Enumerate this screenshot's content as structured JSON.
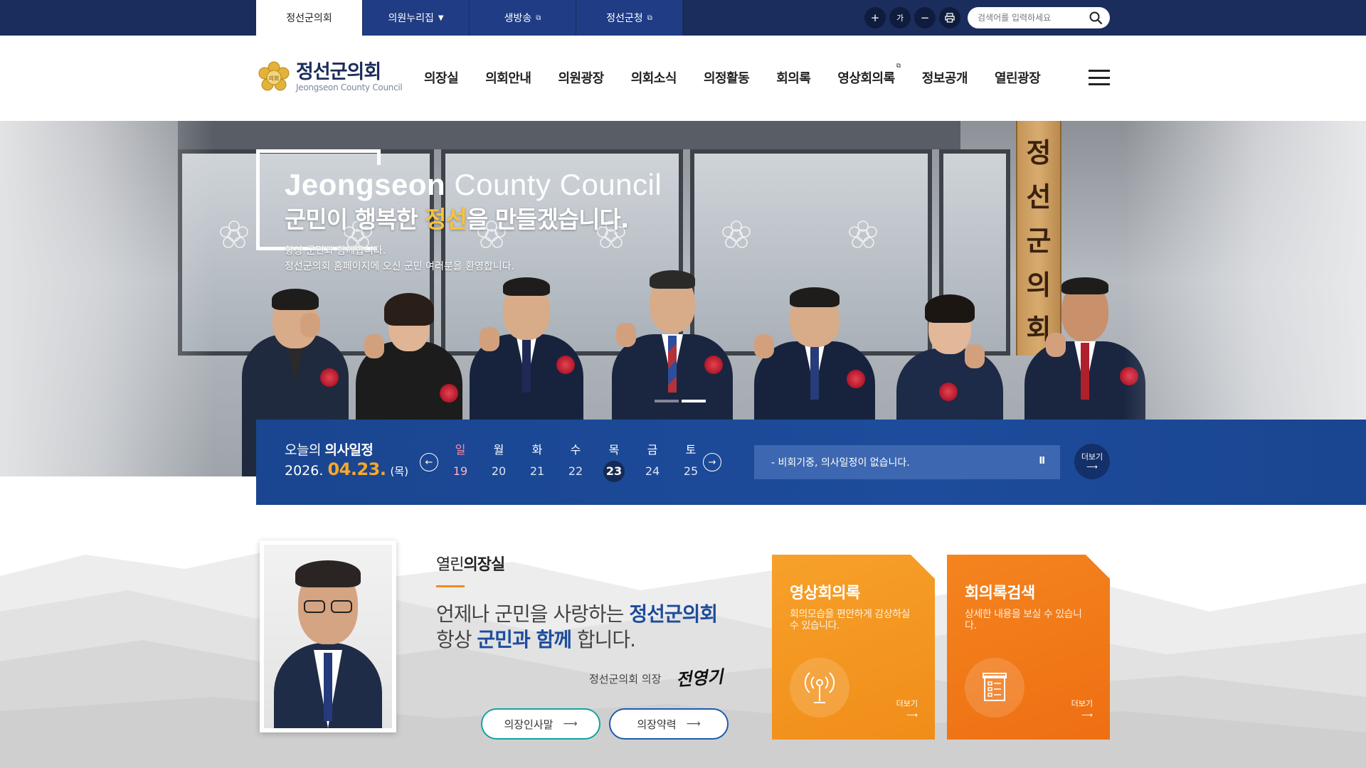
{
  "top_tabs": [
    {
      "label": "정선군의회",
      "active": true,
      "external": false,
      "dropdown": false
    },
    {
      "label": "의원누리집",
      "active": false,
      "external": false,
      "dropdown": true
    },
    {
      "label": "생방송",
      "active": false,
      "external": true,
      "dropdown": false
    },
    {
      "label": "정선군청",
      "active": false,
      "external": true,
      "dropdown": false
    }
  ],
  "utility": {
    "zoom_in_icon": "plus-icon",
    "font_size_label": "가",
    "zoom_out_icon": "minus-icon",
    "print_icon": "print-icon"
  },
  "search": {
    "placeholder": "검색어를 입력하세요",
    "icon": "search-icon"
  },
  "logo": {
    "name": "정선군의회",
    "english": "Jeongseon County Council",
    "emblem_text": "의회"
  },
  "gnb": [
    "의장실",
    "의회안내",
    "의원광장",
    "의회소식",
    "의정활동",
    "회의록",
    "영상회의록",
    "정보공개",
    "열린광장"
  ],
  "gnb_external_index": 6,
  "hero": {
    "title_en_bold": "Jeongseon",
    "title_en_thin": " County Council",
    "title_ko_pre": "군민이 행복한 ",
    "title_ko_hl": "정선",
    "title_ko_post": "을 만들겠습니다.",
    "sub1": "항상 군민과 함께합니다.",
    "sub2": "정선군의회 홈페이지에 오신 군민 여러분을 환영합니다.",
    "sign_chars": [
      "정",
      "선",
      "군",
      "의",
      "회"
    ],
    "slide_count": 2,
    "active_slide": 2
  },
  "schedule": {
    "title_pre": "오늘의 ",
    "title_bold": "의사일정",
    "year": "2026.",
    "date": "04.23.",
    "dow": "(목)",
    "days": [
      {
        "name": "일",
        "date": "19",
        "sun": true,
        "today": false
      },
      {
        "name": "월",
        "date": "20",
        "sun": false,
        "today": false
      },
      {
        "name": "화",
        "date": "21",
        "sun": false,
        "today": false
      },
      {
        "name": "수",
        "date": "22",
        "sun": false,
        "today": false
      },
      {
        "name": "목",
        "date": "23",
        "sun": false,
        "today": true
      },
      {
        "name": "금",
        "date": "24",
        "sun": false,
        "today": false
      },
      {
        "name": "토",
        "date": "25",
        "sun": false,
        "today": false
      }
    ],
    "notice": "- 비회기중, 의사일정이 없습니다.",
    "pause_label": "II",
    "more_label": "더보기"
  },
  "open_office": {
    "title_pre": "열린",
    "title_bold": "의장실",
    "msg1_pre": "언제나 군민을 사랑하는 ",
    "msg1_bold": "정선군의회",
    "msg2_pre": "항상 ",
    "msg2_bold": "군민과 함께",
    "msg2_post": " 합니다.",
    "sig_label": "정선군의회 의장",
    "signature": "전영기",
    "buttons": [
      "의장인사말",
      "의장약력"
    ]
  },
  "cards": [
    {
      "title": "영상회의록",
      "desc": "회의모습을 편안하게 감상하실 수 있습니다.",
      "more": "더보기",
      "icon": "broadcast-icon"
    },
    {
      "title": "회의록검색",
      "desc": "상세한 내용을 보실 수 있습니다.",
      "more": "더보기",
      "icon": "document-list-icon"
    }
  ],
  "colors": {
    "navy": "#1a2d5c",
    "tab_blue": "#203c84",
    "schedule_blue": "#1d4c9c",
    "accent_orange": "#f9a826",
    "highlight_yellow": "#f9c23c",
    "card_orange_1": "#f7a12a",
    "card_orange_2": "#ee6f12",
    "teal": "#15a2a0"
  }
}
